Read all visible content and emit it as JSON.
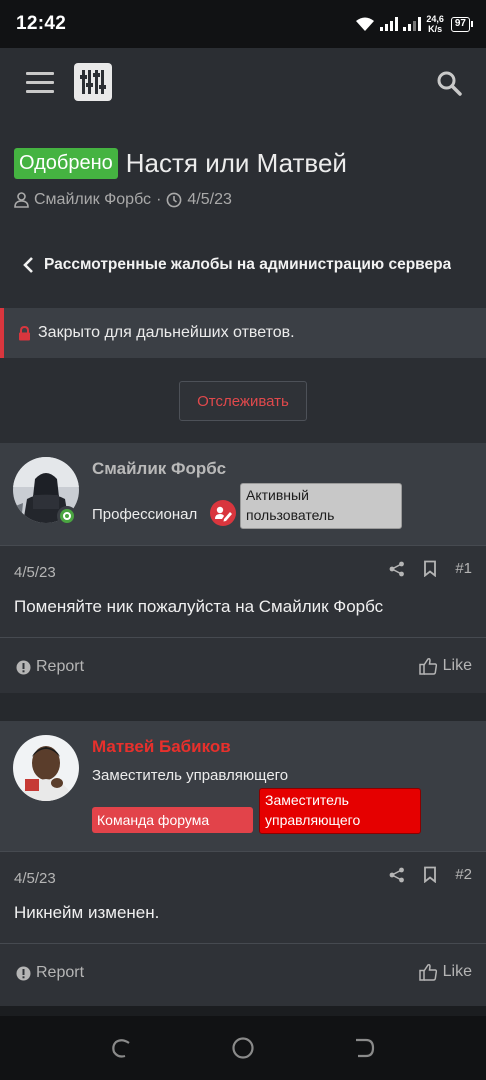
{
  "status_bar": {
    "time": "12:42",
    "net_speed_value": "24,6",
    "net_speed_unit": "K/s",
    "battery": "97"
  },
  "thread": {
    "prefix": "Одобрено",
    "title": "Настя или Матвей",
    "author": "Смайлик Форбс",
    "separator": "·",
    "date": "4/5/23",
    "breadcrumb": "Рассмотренные жалобы на администрацию сервера",
    "closed_notice": "Закрыто для дальнейших ответов.",
    "follow_button": "Отслеживать"
  },
  "posts": [
    {
      "username": "Смайлик Форбс",
      "user_title": "Профессионал",
      "banners": [
        "Активный пользователь"
      ],
      "date": "4/5/23",
      "number": "#1",
      "body": "Поменяйте ник пожалуйста на Смайлик Форбс",
      "report_label": "Report",
      "like_label": "Like"
    },
    {
      "username": "Матвей Бабиков",
      "user_title": "Заместитель управляющего",
      "banners": [
        "Команда форума",
        "Заместитель управляющего"
      ],
      "date": "4/5/23",
      "number": "#2",
      "body": "Никнейм изменен.",
      "report_label": "Report",
      "like_label": "Like"
    }
  ],
  "icons": {
    "menu": "hamburger-menu-icon",
    "logo": "sliders-logo-icon",
    "search": "search-icon",
    "user": "user-icon",
    "clock": "clock-icon",
    "back": "chevron-left-icon",
    "lock": "lock-icon",
    "share": "share-icon",
    "bookmark": "bookmark-icon",
    "report": "alert-icon",
    "like": "thumbs-up-icon"
  },
  "colors": {
    "approved": "#45b341",
    "accent_red": "#e0494c",
    "staff_name": "#e8302c",
    "banner_gray": "#c8c8c8",
    "banner_team": "#e2434a",
    "banner_deputy": "#e50000"
  }
}
